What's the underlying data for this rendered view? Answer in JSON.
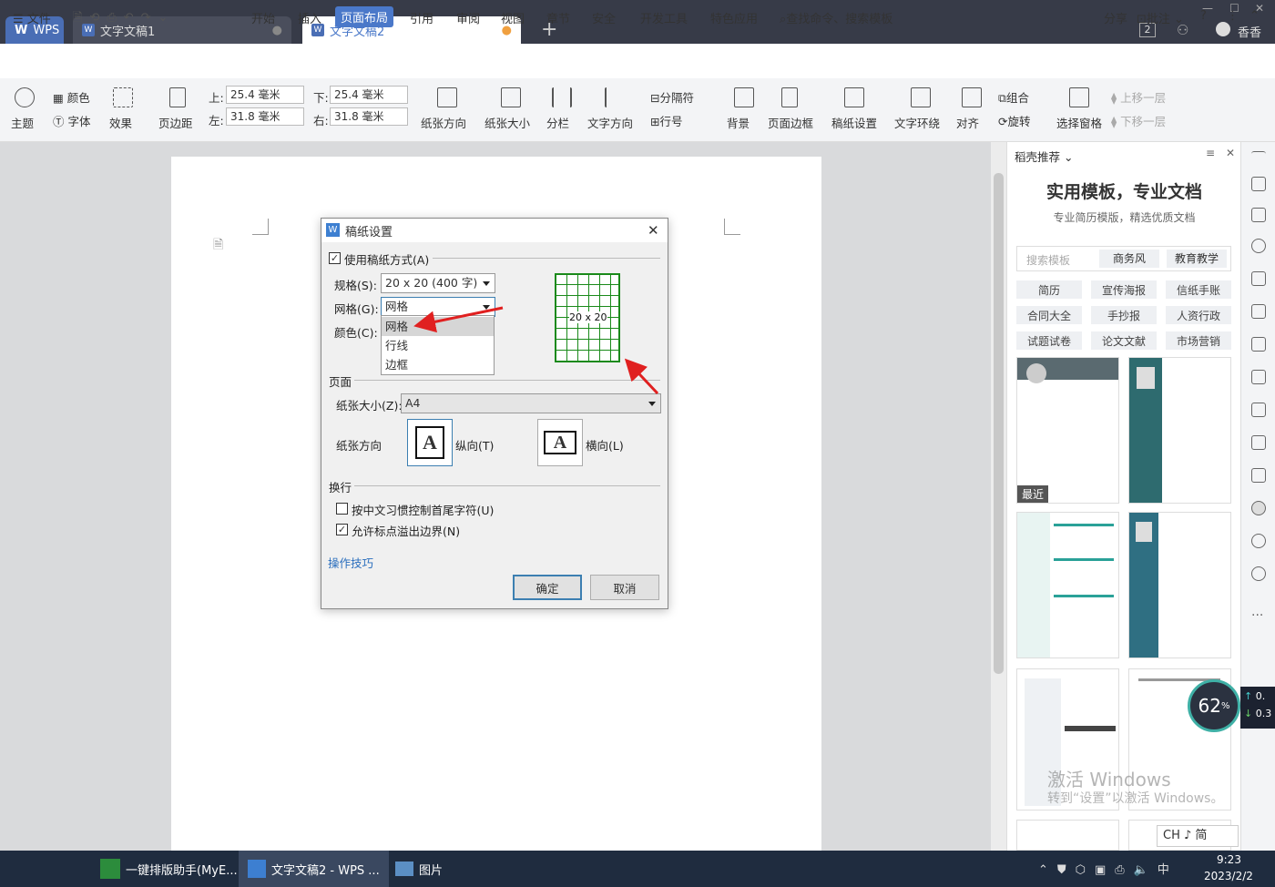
{
  "titlebar": {
    "wps_tab": "WPS",
    "tabs": [
      {
        "label": "文字文稿1"
      },
      {
        "label": "文字文稿2"
      }
    ],
    "badge": "2",
    "user": "香香"
  },
  "menubar": {
    "file": "文件",
    "items": [
      "开始",
      "插入",
      "页面布局",
      "引用",
      "审阅",
      "视图",
      "章节",
      "安全",
      "开发工具",
      "特色应用"
    ],
    "active": "页面布局",
    "search": "查找命令、搜索模板",
    "share": "分享",
    "comment": "批注"
  },
  "ribbon": {
    "theme": "主题",
    "color": "颜色",
    "font": "字体",
    "effect": "效果",
    "margin": "页边距",
    "top_label": "上:",
    "top_val": "25.4 毫米",
    "bottom_label": "下:",
    "bottom_val": "25.4 毫米",
    "left_label": "左:",
    "left_val": "31.8 毫米",
    "right_label": "右:",
    "right_val": "31.8 毫米",
    "orientation": "纸张方向",
    "size": "纸张大小",
    "columns": "分栏",
    "text_dir": "文字方向",
    "separator": "分隔符",
    "line_num": "行号",
    "background": "背景",
    "page_border": "页面边框",
    "grid_paper": "稿纸设置",
    "wrap": "文字环绕",
    "align": "对齐",
    "group": "组合",
    "rotate": "旋转",
    "select_pane": "选择窗格",
    "bring_forward": "上移一层",
    "send_backward": "下移一层"
  },
  "dialog": {
    "title": "稿纸设置",
    "use_grid": "使用稿纸方式(A)",
    "spec_label": "规格(S):",
    "spec_val": "20 x 20 (400 字)",
    "grid_label": "网格(G):",
    "grid_val": "网格",
    "color_label": "颜色(C):",
    "dropdown": [
      "网格",
      "行线",
      "边框"
    ],
    "preview": "20 x 20",
    "page_section": "页面",
    "paper_size_label": "纸张大小(Z):",
    "paper_size_val": "A4",
    "orient_label": "纸张方向",
    "portrait": "纵向(T)",
    "landscape": "横向(L)",
    "portrait_glyph": "A",
    "landscape_glyph": "A",
    "wrap_section": "换行",
    "opt1": "按中文习惯控制首尾字符(U)",
    "opt2": "允许标点溢出边界(N)",
    "tips": "操作技巧",
    "ok": "确定",
    "cancel": "取消"
  },
  "panel": {
    "header": "稻壳推荐",
    "title": "实用模板，专业文档",
    "subtitle": "专业简历模版，精选优质文档",
    "search_placeholder": "搜索模板",
    "search_tags": [
      "商务风",
      "教育教学"
    ],
    "tags": [
      "简历",
      "宣传海报",
      "信纸手账",
      "合同大全",
      "手抄报",
      "人资行政",
      "试题试卷",
      "论文文献",
      "市场营销"
    ],
    "recent": "最近"
  },
  "overlay": {
    "percent": "62",
    "percent_sign": "%",
    "net_up": "0.",
    "net_down": "0.3",
    "watermark1": "激活 Windows",
    "watermark2": "转到“设置”以激活 Windows。",
    "ime": "CH ♪ 简"
  },
  "taskbar": {
    "items": [
      "一键排版助手(MyE...",
      "文字文稿2 - WPS ...",
      "图片"
    ],
    "time": "9:23",
    "date": "2023/2/2"
  }
}
